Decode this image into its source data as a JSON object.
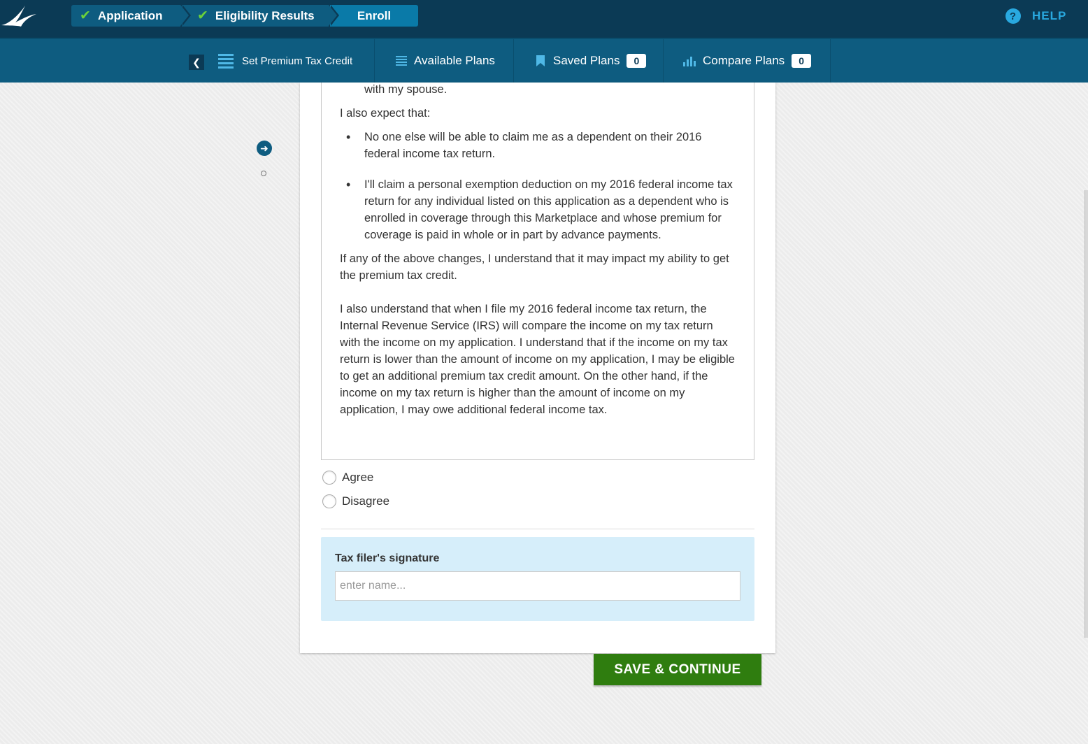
{
  "progress": {
    "steps": [
      {
        "label": "Application",
        "done": true
      },
      {
        "label": "Eligibility Results",
        "done": true
      },
      {
        "label": "Enroll",
        "done": false
      }
    ],
    "help_label": "HELP"
  },
  "subnav": {
    "back_label": "<",
    "set_premium": "Set Premium Tax Credit",
    "available_plans": "Available Plans",
    "saved_plans": "Saved Plans",
    "saved_count": "0",
    "compare_plans": "Compare Plans",
    "compare_count": "0"
  },
  "attestation": {
    "top_fragment": "with my spouse.",
    "expect_intro": "I also expect that:",
    "bullets": [
      "No one else will be able to claim me as a dependent on their 2016 federal income tax return.",
      "I'll claim a personal exemption deduction on my 2016 federal income tax return for any individual listed on this application as a dependent who is enrolled in coverage through this Marketplace and whose premium for coverage is paid in whole or in part by advance payments."
    ],
    "changes_text": "If any of the above changes, I understand that it may impact my ability to get the premium tax credit.",
    "irs_text": "I also understand that when I file my 2016 federal income tax return, the Internal Revenue Service (IRS) will compare the income on my tax return with the income on my application. I understand that if the income on my tax return is lower than the amount of income on my application, I may be eligible to get an additional premium tax credit amount. On the other hand, if the income on my tax return is higher than the amount of income on my application, I may owe additional federal income tax."
  },
  "choices": {
    "agree": "Agree",
    "disagree": "Disagree"
  },
  "signature": {
    "label": "Tax filer's signature",
    "placeholder": "enter name...",
    "value": ""
  },
  "actions": {
    "save_continue": "SAVE & CONTINUE"
  },
  "colors": {
    "topbar": "#0b3a55",
    "subnav": "#0e5c80",
    "check": "#6bd23a",
    "help": "#29a9e0",
    "save": "#2f7d0f",
    "signature_bg": "#d6eefa"
  }
}
